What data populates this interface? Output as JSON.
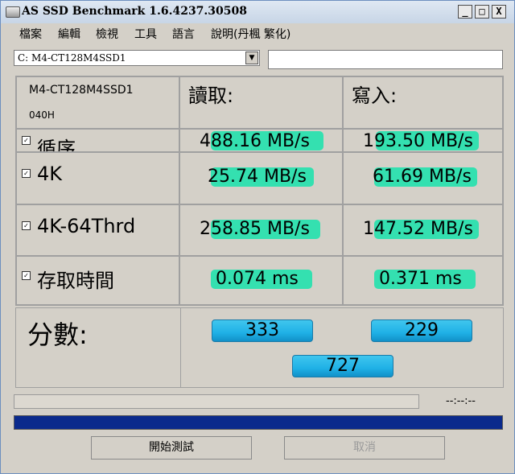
{
  "window": {
    "title": "AS SSD Benchmark 1.6.4237.30508"
  },
  "title_buttons": {
    "minimize": "_",
    "maximize": "□",
    "close": "X"
  },
  "menu": [
    "檔案",
    "編輯",
    "檢視",
    "工具",
    "語言",
    "說明(丹楓 繁化)"
  ],
  "drive_select": {
    "value": "C: M4-CT128M4SSD1",
    "arrow": "▼"
  },
  "info": {
    "drive_model": "M4-CT128M4SSD1",
    "firmware": "040H"
  },
  "headers": {
    "read": "讀取:",
    "write": "寫入:"
  },
  "rows": [
    {
      "label": "循序",
      "checked": true,
      "read": "488.16 MB/s",
      "write": "193.50 MB/s"
    },
    {
      "label": "4K",
      "checked": true,
      "read": "25.74 MB/s",
      "write": "61.69 MB/s"
    },
    {
      "label": "4K-64Thrd",
      "checked": true,
      "read": "258.85 MB/s",
      "write": "147.52 MB/s"
    },
    {
      "label": "存取時間",
      "checked": true,
      "read": "0.074 ms",
      "write": "0.371 ms"
    }
  ],
  "score": {
    "label": "分數:",
    "read": "333",
    "write": "229",
    "total": "727"
  },
  "status": {
    "time": "--:--:--",
    "progress_fraction": 1.0
  },
  "buttons": {
    "start": "開始測試",
    "cancel": "取消"
  },
  "colors": {
    "value_bar": "#34e0b0",
    "score_bar": "#1fb1e6",
    "progress": "#0b2a8c"
  }
}
